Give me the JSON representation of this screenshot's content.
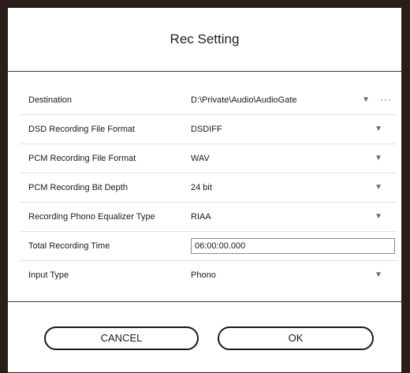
{
  "dialog": {
    "title": "Rec Setting",
    "rows": [
      {
        "label": "Destination",
        "value": "D:\\Private\\Audio\\AudioGate",
        "control": "dropdown",
        "more": "···"
      },
      {
        "label": "DSD Recording File Format",
        "value": "DSDIFF",
        "control": "dropdown"
      },
      {
        "label": "PCM Recording File Format",
        "value": "WAV",
        "control": "dropdown"
      },
      {
        "label": "PCM Recording Bit Depth",
        "value": "24 bit",
        "control": "dropdown"
      },
      {
        "label": "Recording Phono Equalizer Type",
        "value": "RIAA",
        "control": "dropdown"
      },
      {
        "label": "Total Recording Time",
        "value": "06:00:00.000",
        "control": "text-input"
      },
      {
        "label": "Input Type",
        "value": "Phono",
        "control": "dropdown"
      }
    ],
    "caret_glyph": "▼",
    "buttons": {
      "cancel": "CANCEL",
      "ok": "OK"
    }
  }
}
